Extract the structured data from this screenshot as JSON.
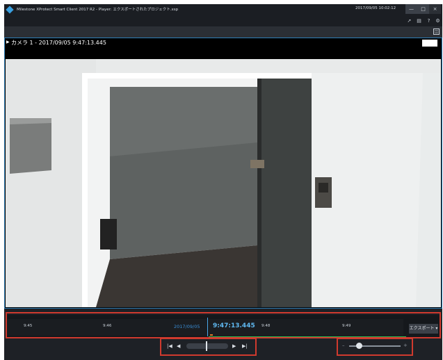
{
  "window": {
    "title": "Milestone XProtect Smart Client 2017 R2 - Player: エクスポートされたプロジェクト.xsp",
    "clock": "2017/09/05 10:02:12",
    "controls": {
      "minimize": "—",
      "maximize": "□",
      "close": "×"
    }
  },
  "toolbar": {
    "icons": [
      "pointer-icon",
      "monitor-icon",
      "help-icon",
      "settings-icon"
    ]
  },
  "subbar": {
    "icon": "setup-icon"
  },
  "camera": {
    "title": "カメラ 1 - 2017/09/05 9:47:13.445"
  },
  "timeline": {
    "ticks": [
      "9:45",
      "9:46",
      "9:48",
      "9:49"
    ],
    "date": "2017/09/05",
    "current_time": "9:47:13.445",
    "export_label": "エクスポート ▾"
  },
  "transport": {
    "prev": "|◀",
    "back": "◀",
    "forward": "▶",
    "next": "▶|"
  },
  "speed": {
    "minus": "–",
    "plus": "+"
  },
  "colors": {
    "accent": "#4aa8e8",
    "highlight": "#d03a2e",
    "recording": "#2bbf55"
  }
}
